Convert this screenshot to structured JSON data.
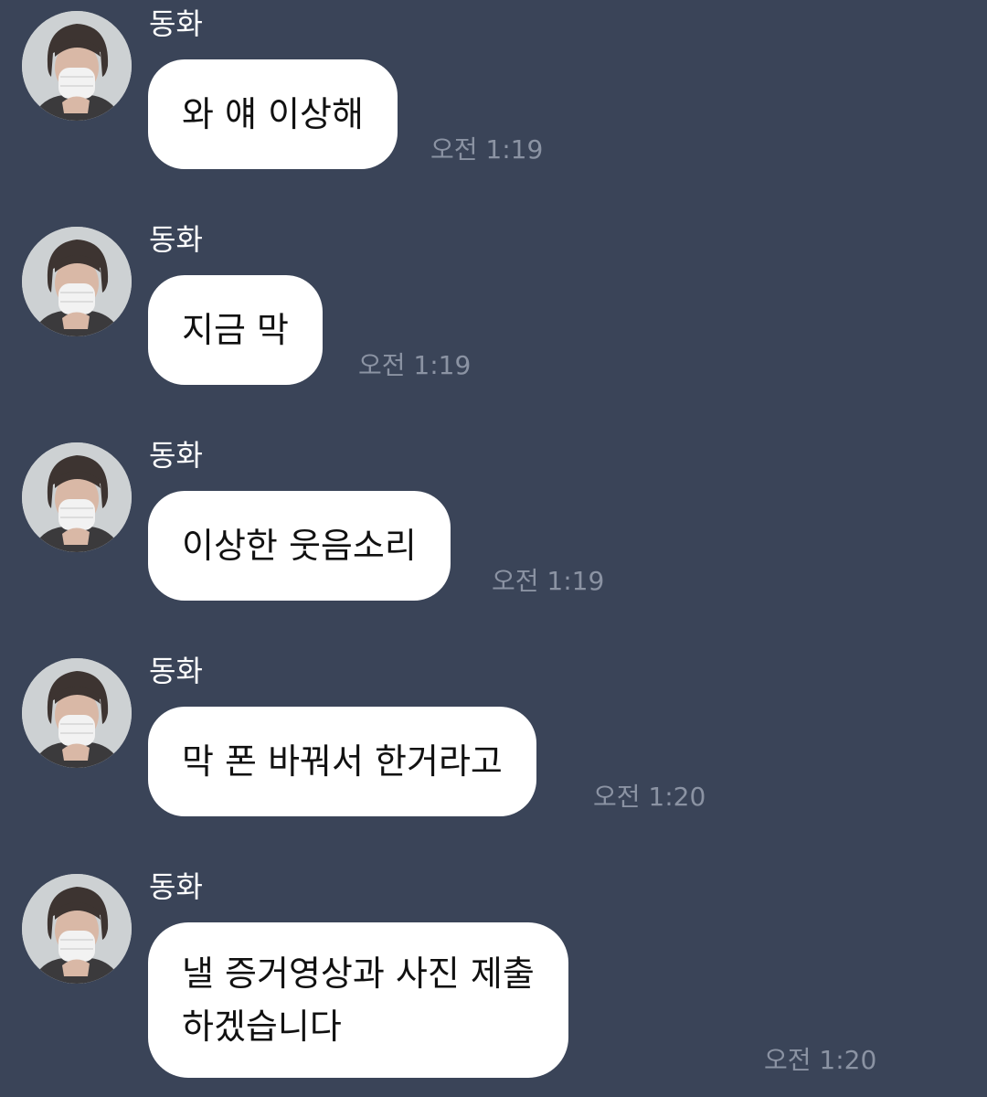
{
  "sender": "동화",
  "avatar_icon": "profile-photo-masked-person",
  "colors": {
    "background": "#3a4458",
    "bubble": "#ffffff",
    "timestamp": "#8b93a3"
  },
  "messages": [
    {
      "text": "와 얘 이상해",
      "time": "오전 1:19"
    },
    {
      "text": "지금 막",
      "time": "오전 1:19"
    },
    {
      "text": "이상한 웃음소리",
      "time": "오전 1:19"
    },
    {
      "text": "막 폰 바꿔서 한거라고",
      "time": "오전 1:20"
    },
    {
      "text": "낼 증거영상과 사진 제출\n하겠습니다",
      "time": "오전 1:20"
    }
  ]
}
